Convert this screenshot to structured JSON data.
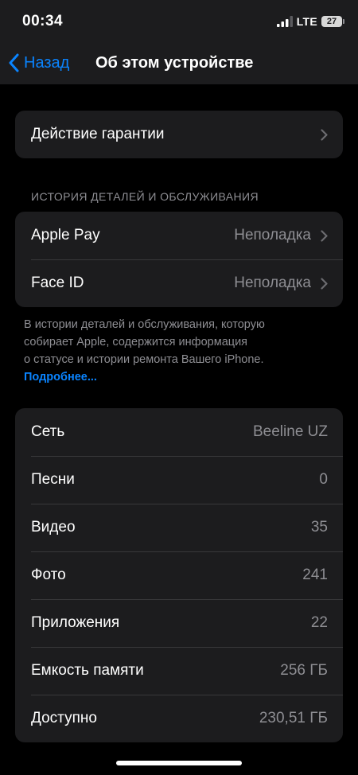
{
  "status_bar": {
    "time": "00:34",
    "network": "LTE",
    "battery": "27",
    "signal_icon": "cellular-signal-icon",
    "battery_icon": "battery-icon"
  },
  "nav": {
    "back_label": "Назад",
    "title": "Об этом устройстве",
    "back_icon": "chevron-left-icon"
  },
  "warranty": {
    "label": "Действие гарантии"
  },
  "parts_section": {
    "header": "ИСТОРИЯ ДЕТАЛЕЙ И ОБСЛУЖИВАНИЯ",
    "items": [
      {
        "label": "Apple Pay",
        "value": "Неполадка"
      },
      {
        "label": "Face ID",
        "value": "Неполадка"
      }
    ],
    "note_lines": [
      "В истории деталей и обслуживания, которую",
      "собирает Apple, содержится информация",
      "о статусе и истории ремонта Вашего iPhone."
    ],
    "link": "Подробнее..."
  },
  "info": {
    "rows": [
      {
        "label": "Сеть",
        "value": "Beeline UZ"
      },
      {
        "label": "Песни",
        "value": "0"
      },
      {
        "label": "Видео",
        "value": "35"
      },
      {
        "label": "Фото",
        "value": "241"
      },
      {
        "label": "Приложения",
        "value": "22"
      },
      {
        "label": "Емкость памяти",
        "value": "256 ГБ"
      },
      {
        "label": "Доступно",
        "value": "230,51 ГБ"
      }
    ]
  },
  "colors": {
    "background": "#000000",
    "cell": "#1c1c1e",
    "accent": "#0a84ff",
    "secondary_text": "#8e8e93",
    "separator": "#38383a"
  }
}
